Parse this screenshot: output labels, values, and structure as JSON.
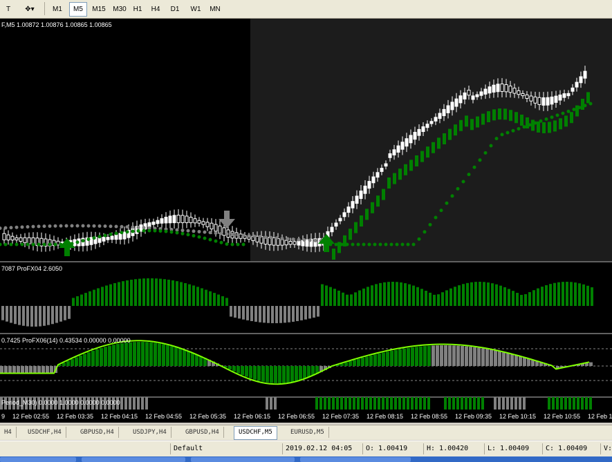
{
  "toolbar": {
    "timeframes": [
      "M1",
      "M5",
      "M15",
      "M30",
      "H1",
      "H4",
      "D1",
      "W1",
      "MN"
    ],
    "active_timeframe": "M5"
  },
  "chart": {
    "main_label": "F,M5  1.00872 1.00876 1.00865 1.00865",
    "indicator1_label": "7087  ProFX04 2.6050",
    "indicator2_label": "0.7425  ProFX06(14) 0.43534 0.00000 0.00000",
    "indicator3_label": "Period_M30) 0.0000  1.0000 0.0000 0.0000"
  },
  "xaxis": {
    "ticks": [
      "9",
      "12 Feb 02:55",
      "12 Feb 03:35",
      "12 Feb 04:15",
      "12 Feb 04:55",
      "12 Feb 05:35",
      "12 Feb 06:15",
      "12 Feb 06:55",
      "12 Feb 07:35",
      "12 Feb 08:15",
      "12 Feb 08:55",
      "12 Feb 09:35",
      "12 Feb 10:15",
      "12 Feb 10:55",
      "12 Feb 1"
    ]
  },
  "tabs": [
    "H4",
    "USDCHF,H4",
    "GBPUSD,H4",
    "USDJPY,H4",
    "GBPUSD,H4",
    "USDCHF,M5",
    "EURUSD,M5"
  ],
  "active_tab": "USDCHF,M5",
  "status": {
    "profile": "Default",
    "datetime": "2019.02.12 04:05",
    "open": "O: 1.00419",
    "high": "H: 1.00420",
    "low": "L: 1.00409",
    "close": "C: 1.00409",
    "volume": "V:"
  },
  "colors": {
    "bull": "#008000",
    "bear": "#808080",
    "line": "#7fff00",
    "shade": "#1a1a1a"
  }
}
